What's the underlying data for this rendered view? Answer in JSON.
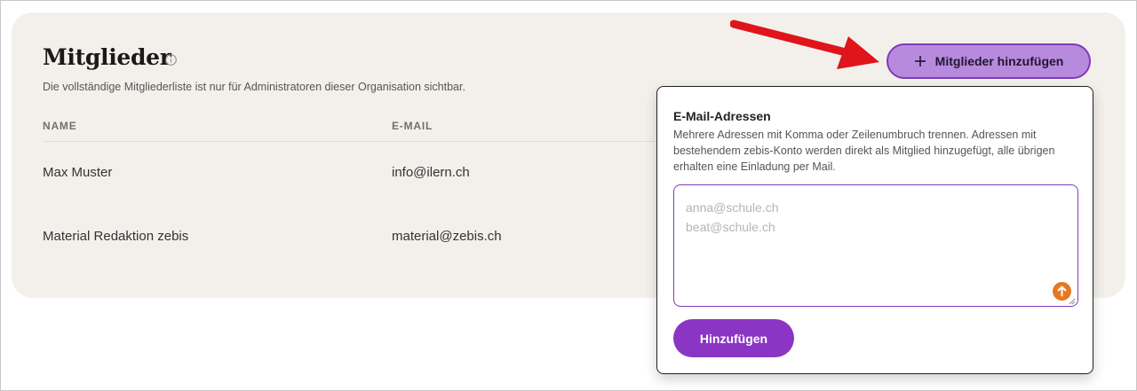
{
  "members": {
    "title": "Mitglieder",
    "subtitle": "Die vollständige Mitgliederliste ist nur für Administratoren dieser Organisation sichtbar.",
    "columns": {
      "name": "NAME",
      "email": "E-MAIL"
    },
    "rows": [
      {
        "name": "Max Muster",
        "email": "info@ilern.ch"
      },
      {
        "name": "Material Redaktion zebis",
        "email": "material@zebis.ch"
      }
    ],
    "add_button_label": "Mitglieder hinzufügen"
  },
  "popover": {
    "label": "E-Mail-Adressen",
    "help": "Mehrere Adressen mit Komma oder Zeilenumbruch trennen. Adressen mit bestehendem zebis-Konto werden direkt als Mitglied hinzugefügt, alle übrigen erhalten eine Einladung per Mail.",
    "placeholder": "anna@schule.ch\nbeat@schule.ch",
    "submit_label": "Hinzufügen"
  },
  "icons": {
    "info": "info-icon",
    "plus": "plus-icon",
    "upload": "upload-icon",
    "annotation": "red-arrow-icon"
  },
  "colors": {
    "card_bg": "#f3f0eb",
    "add_button_bg": "#b88add",
    "accent_purple": "#8a35c4",
    "upload_orange": "#e8771e",
    "annotation_red": "#e0141b"
  }
}
